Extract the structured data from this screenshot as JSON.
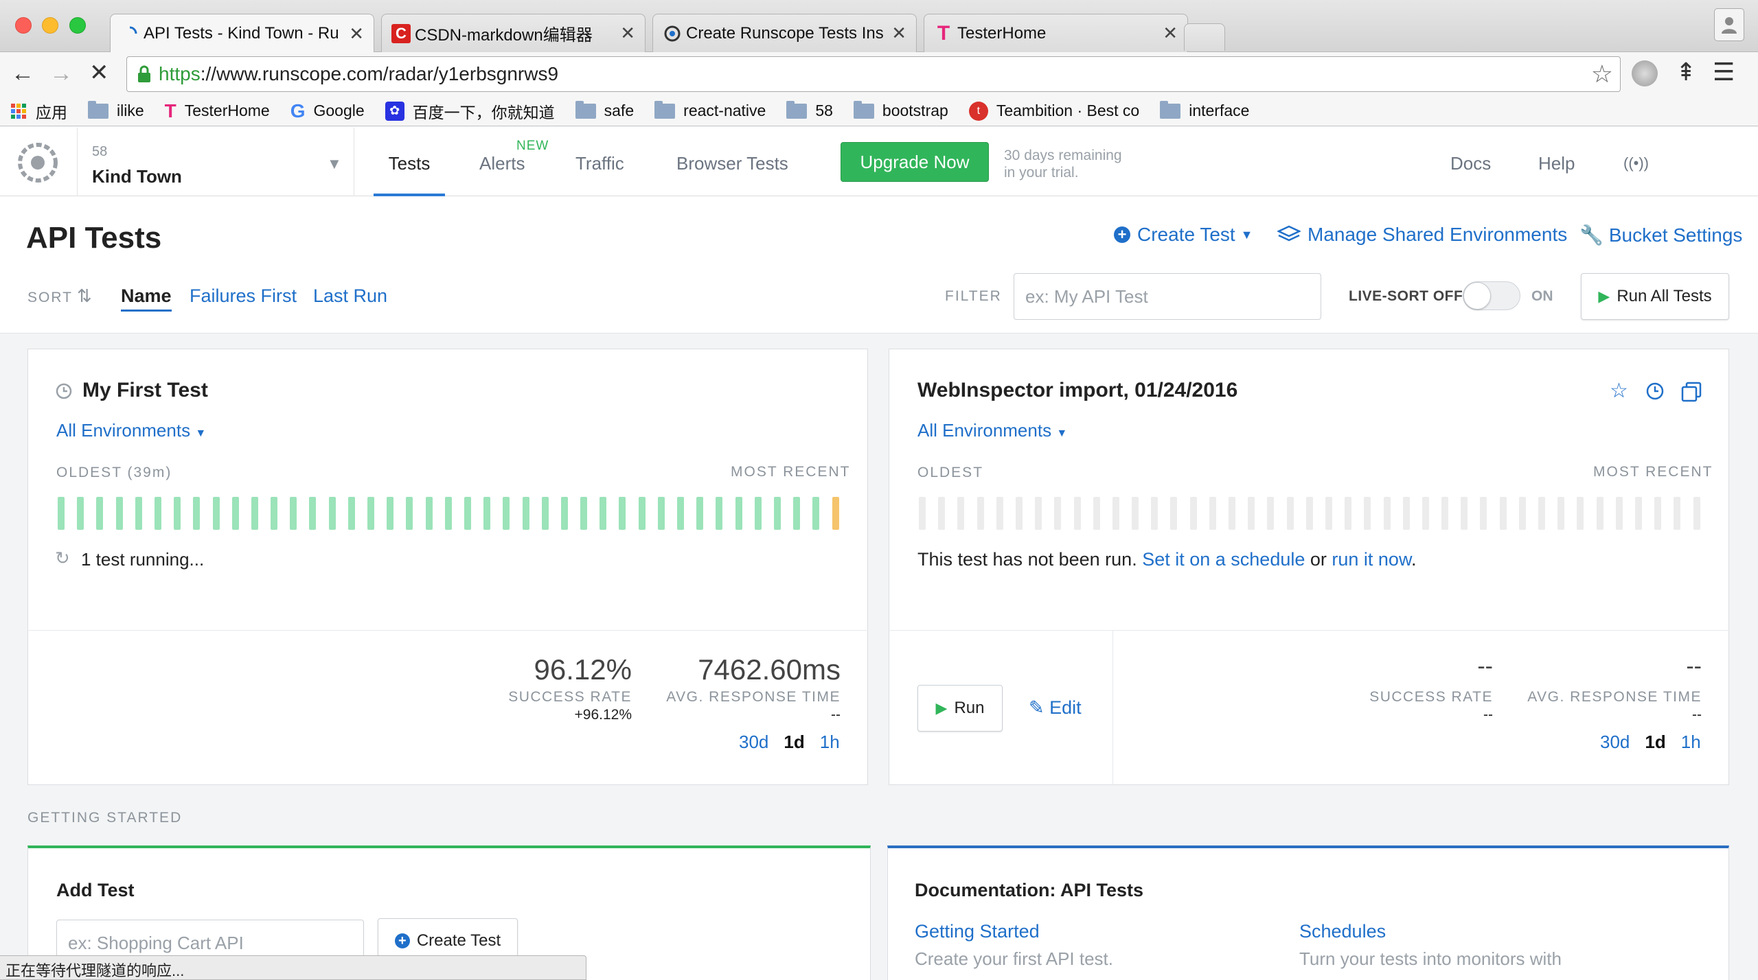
{
  "browser": {
    "tabs": [
      {
        "title": "API Tests - Kind Town - Ru",
        "active": true
      },
      {
        "title": "CSDN-markdown编辑器",
        "active": false
      },
      {
        "title": "Create Runscope Tests Ins",
        "active": false
      },
      {
        "title": "TesterHome",
        "active": false
      }
    ],
    "url_scheme": "https",
    "url_rest": "://www.runscope.com/radar/y1erbsgnrws9",
    "bookmarks": [
      {
        "label": "应用",
        "icon": "apps-grid-icon"
      },
      {
        "label": "ilike",
        "icon": "folder-icon"
      },
      {
        "label": "TesterHome",
        "icon": "testerhome-icon"
      },
      {
        "label": "Google",
        "icon": "google-icon"
      },
      {
        "label": "百度一下，你就知道",
        "icon": "baidu-icon"
      },
      {
        "label": "safe",
        "icon": "folder-icon"
      },
      {
        "label": "react-native",
        "icon": "folder-icon"
      },
      {
        "label": "58",
        "icon": "folder-icon"
      },
      {
        "label": "bootstrap",
        "icon": "folder-icon"
      },
      {
        "label": "Teambition · Best co",
        "icon": "teambition-icon"
      },
      {
        "label": "interface",
        "icon": "folder-icon"
      }
    ],
    "status_text": "正在等待代理隧道的响应..."
  },
  "app": {
    "team_number": "58",
    "team_name": "Kind Town",
    "nav": {
      "tests": "Tests",
      "alerts": "Alerts",
      "alerts_badge": "NEW",
      "traffic": "Traffic",
      "browser_tests": "Browser Tests",
      "upgrade": "Upgrade Now",
      "trial_line1": "30 days remaining",
      "trial_line2": "in your trial.",
      "docs": "Docs",
      "help": "Help"
    },
    "colors": {
      "accent": "#1f6fc9",
      "success": "#31b55a",
      "bar_pass": "#9be3b9",
      "bar_running": "#f5c46c",
      "bar_empty": "#ececec"
    }
  },
  "page": {
    "title": "API Tests",
    "create_test": "Create Test",
    "manage_envs": "Manage Shared Environments",
    "bucket_settings": "Bucket Settings",
    "sort_label": "SORT",
    "sort_options": [
      "Name",
      "Failures First",
      "Last Run"
    ],
    "filter_label": "FILTER",
    "filter_placeholder": "ex: My API Test",
    "live_sort_off": "LIVE-SORT OFF",
    "live_sort_on": "ON",
    "run_all": "Run All Tests"
  },
  "tests": [
    {
      "name": "My First Test",
      "env": "All Environments",
      "oldest": "OLDEST (39m)",
      "most_recent": "MOST RECENT",
      "status": "1 test running...",
      "success_rate": "96.12%",
      "success_label": "SUCCESS RATE",
      "success_delta": "+96.12%",
      "avg_time": "7462.60ms",
      "avg_label": "AVG. RESPONSE TIME",
      "avg_delta": "--",
      "ranges": [
        "30d",
        "1d",
        "1h"
      ],
      "current_range": "1d"
    },
    {
      "name": "WebInspector import, 01/24/2016",
      "env": "All Environments",
      "oldest": "OLDEST",
      "most_recent": "MOST RECENT",
      "status_prefix": "This test has not been run. ",
      "status_link1": "Set it on a schedule",
      "status_mid": " or ",
      "status_link2": "run it now",
      "status_suffix": ".",
      "run": "Run",
      "edit": "Edit",
      "success_rate": "--",
      "success_label": "SUCCESS RATE",
      "success_delta": "--",
      "avg_time": "--",
      "avg_label": "AVG. RESPONSE TIME",
      "avg_delta": "--",
      "ranges": [
        "30d",
        "1d",
        "1h"
      ],
      "current_range": "1d"
    }
  ],
  "getting_started": {
    "heading": "GETTING STARTED",
    "add_test_title": "Add Test",
    "add_test_placeholder": "ex: Shopping Cart API",
    "create_test": "Create Test",
    "docs_title": "Documentation: API Tests",
    "doc_links": [
      {
        "title": "Getting Started",
        "desc": "Create your first API test."
      },
      {
        "title": "Schedules",
        "desc": "Turn your tests into monitors with"
      }
    ]
  }
}
